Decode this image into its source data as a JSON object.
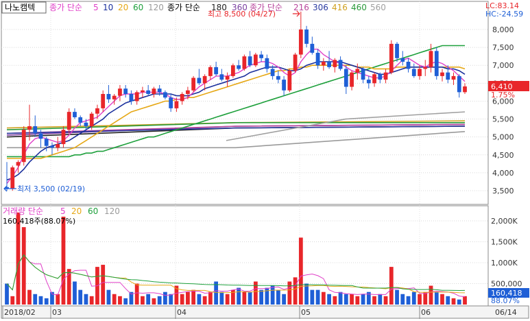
{
  "header": {
    "ticker": "나노캠텍",
    "ma_price_label": "종가 단순",
    "ma_price_periods": [
      "5",
      "10",
      "20",
      "60",
      "120"
    ],
    "ma_price_long_label": "종가 단순",
    "ma_price_long_periods": [
      "180",
      "360"
    ],
    "ma_price_long2_label": "종가 단순",
    "ma_price_long2_periods": [
      "216",
      "306",
      "416",
      "460",
      "560"
    ],
    "lc": "LC:83.14",
    "hc": "HC:-24.59"
  },
  "volume_header": {
    "label": "거래량 단순",
    "periods": [
      "5",
      "20",
      "60",
      "120"
    ],
    "current": "160,418주(88.07%)"
  },
  "annotations": {
    "high": "최고 8,500 (04/27)",
    "low": "최저 3,500 (02/19)"
  },
  "price_badge": {
    "value": "6,410",
    "change": "1.75%"
  },
  "volume_badge": {
    "value": "160,418",
    "pct": "88.07%"
  },
  "colors": {
    "up": "#e8262a",
    "down": "#1f5fd6",
    "ma5": "#e040c8",
    "ma10": "#1a2f9c",
    "ma20": "#e6a816",
    "ma60": "#1ea03c",
    "ma120": "#9a9a9a",
    "ma180": "#222222",
    "ma360": "#7a3fa0",
    "ma216": "#b8469c",
    "ma306": "#2a3aa0",
    "ma416": "#d0a020",
    "ma460": "#2a9a3a",
    "ma560": "#a0a0a0"
  },
  "chart_data": [
    {
      "type": "candlestick",
      "title": "나노캠텍",
      "ylim": [
        3000,
        8500
      ],
      "y_ticks": [
        "3,500",
        "4,000",
        "4,500",
        "5,000",
        "5,500",
        "6,000",
        "6,500",
        "7,000",
        "7,500",
        "8,000"
      ],
      "x_ticks": [
        "2018/02",
        "03",
        "04",
        "05",
        "06",
        "06/14"
      ],
      "candles": [
        [
          3600,
          4300,
          3500,
          3550
        ],
        [
          3550,
          4200,
          3500,
          4150
        ],
        [
          4200,
          4350,
          4000,
          4300
        ],
        [
          4300,
          5300,
          4200,
          5200
        ],
        [
          5200,
          5900,
          4900,
          5300
        ],
        [
          5300,
          5600,
          5000,
          5100
        ],
        [
          5100,
          5200,
          4700,
          4950
        ],
        [
          4950,
          5000,
          4600,
          4750
        ],
        [
          4750,
          4850,
          4500,
          4700
        ],
        [
          4700,
          5000,
          4600,
          4800
        ],
        [
          4800,
          5300,
          4700,
          5200
        ],
        [
          5200,
          5800,
          5100,
          5700
        ],
        [
          5700,
          5800,
          5500,
          5550
        ],
        [
          5550,
          5600,
          5300,
          5400
        ],
        [
          5400,
          5500,
          5200,
          5300
        ],
        [
          5300,
          5700,
          5200,
          5650
        ],
        [
          5650,
          5900,
          5500,
          5800
        ],
        [
          5800,
          6300,
          5700,
          6200
        ],
        [
          6200,
          6450,
          5950,
          6050
        ],
        [
          6050,
          6200,
          5900,
          6150
        ],
        [
          6150,
          6450,
          6000,
          6350
        ],
        [
          6350,
          6450,
          6100,
          6200
        ],
        [
          6200,
          6300,
          5900,
          6000
        ],
        [
          6000,
          6300,
          5900,
          6250
        ],
        [
          6250,
          6400,
          6100,
          6300
        ],
        [
          6300,
          6450,
          6150,
          6200
        ],
        [
          6200,
          6400,
          6100,
          6350
        ],
        [
          6350,
          6450,
          6150,
          6250
        ],
        [
          6250,
          6300,
          6050,
          6100
        ],
        [
          6100,
          6200,
          5700,
          5800
        ],
        [
          5800,
          6100,
          5700,
          6000
        ],
        [
          6000,
          6250,
          5900,
          6200
        ],
        [
          6200,
          6400,
          6050,
          6300
        ],
        [
          6300,
          6700,
          6250,
          6650
        ],
        [
          6650,
          6900,
          6450,
          6500
        ],
        [
          6500,
          6750,
          6300,
          6700
        ],
        [
          6700,
          7000,
          6600,
          6950
        ],
        [
          6950,
          7100,
          6700,
          6750
        ],
        [
          6750,
          6900,
          6550,
          6600
        ],
        [
          6600,
          6800,
          6400,
          6700
        ],
        [
          6700,
          7050,
          6650,
          7000
        ],
        [
          7000,
          7150,
          6850,
          6900
        ],
        [
          6900,
          7300,
          6850,
          7250
        ],
        [
          7250,
          7400,
          6950,
          7000
        ],
        [
          7000,
          7350,
          6950,
          7300
        ],
        [
          7300,
          7400,
          7100,
          7200
        ],
        [
          7200,
          7300,
          6800,
          6900
        ],
        [
          6900,
          7000,
          6600,
          6700
        ],
        [
          6700,
          6850,
          6500,
          6600
        ],
        [
          6600,
          6700,
          6150,
          6300
        ],
        [
          6300,
          6900,
          6250,
          6850
        ],
        [
          6850,
          7350,
          6800,
          7300
        ],
        [
          7300,
          8500,
          7200,
          8000
        ],
        [
          8000,
          8100,
          7500,
          7600
        ],
        [
          7600,
          7800,
          7300,
          7350
        ],
        [
          7350,
          7450,
          6900,
          7000
        ],
        [
          7000,
          7200,
          6850,
          7100
        ],
        [
          7100,
          7400,
          6900,
          6950
        ],
        [
          6950,
          7200,
          6800,
          7150
        ],
        [
          7150,
          7250,
          6850,
          6900
        ],
        [
          6900,
          7000,
          6200,
          6400
        ],
        [
          6400,
          6850,
          6300,
          6800
        ],
        [
          6800,
          7050,
          6600,
          6900
        ],
        [
          6900,
          6950,
          6500,
          6600
        ],
        [
          6600,
          6700,
          6350,
          6500
        ],
        [
          6500,
          6800,
          6400,
          6750
        ],
        [
          6750,
          6800,
          6500,
          6600
        ],
        [
          6600,
          6900,
          6500,
          6800
        ],
        [
          6800,
          7700,
          6750,
          7600
        ],
        [
          7600,
          7650,
          7100,
          7200
        ],
        [
          7200,
          7400,
          7000,
          7100
        ],
        [
          7100,
          7200,
          6800,
          6900
        ],
        [
          6900,
          7050,
          6650,
          6700
        ],
        [
          6700,
          7000,
          6600,
          6900
        ],
        [
          6900,
          7150,
          6700,
          6950
        ],
        [
          6950,
          7600,
          6800,
          7400
        ],
        [
          7400,
          7500,
          6600,
          6700
        ],
        [
          6700,
          6900,
          6550,
          6800
        ],
        [
          6800,
          7000,
          6500,
          6600
        ],
        [
          6600,
          6800,
          6450,
          6700
        ],
        [
          6700,
          6750,
          6100,
          6250
        ],
        [
          6250,
          6500,
          6200,
          6410
        ]
      ],
      "ma5": [
        3700,
        3900,
        4150,
        4500,
        4800,
        4950,
        5000,
        4950,
        4900,
        4850,
        4900,
        5050,
        5250,
        5400,
        5450,
        5500,
        5550,
        5700,
        5850,
        6000,
        6150,
        6200,
        6200,
        6200,
        6250,
        6250,
        6250,
        6250,
        6200,
        6100,
        6050,
        6050,
        6100,
        6250,
        6400,
        6500,
        6600,
        6700,
        6700,
        6700,
        6750,
        6800,
        6900,
        7000,
        7050,
        7100,
        7100,
        7050,
        6950,
        6800,
        6700,
        6800,
        7100,
        7300,
        7450,
        7450,
        7300,
        7200,
        7100,
        7050,
        6950,
        6850,
        6800,
        6750,
        6700,
        6650,
        6650,
        6700,
        6850,
        7000,
        7150,
        7200,
        7100,
        7000,
        6950,
        7050,
        7100,
        7050,
        6950,
        6850,
        6700,
        6550
      ],
      "ma10": [
        3800,
        3850,
        3950,
        4100,
        4300,
        4450,
        4600,
        4700,
        4750,
        4800,
        4850,
        4900,
        5000,
        5100,
        5200,
        5300,
        5400,
        5500,
        5650,
        5750,
        5850,
        5950,
        6000,
        6050,
        6100,
        6150,
        6200,
        6200,
        6200,
        6200,
        6150,
        6150,
        6150,
        6200,
        6250,
        6350,
        6400,
        6450,
        6500,
        6550,
        6600,
        6650,
        6700,
        6800,
        6850,
        6900,
        6950,
        6950,
        6950,
        6900,
        6850,
        6850,
        6900,
        7000,
        7050,
        7100,
        7100,
        7100,
        7100,
        7100,
        7050,
        7000,
        6950,
        6900,
        6850,
        6800,
        6750,
        6750,
        6800,
        6850,
        6900,
        6950,
        6950,
        6950,
        6950,
        6950,
        6950,
        6950,
        6900,
        6900,
        6850,
        6750
      ],
      "ma20": [
        4400,
        4400,
        4400,
        4400,
        4400,
        4400,
        4400,
        4450,
        4500,
        4550,
        4600,
        4650,
        4700,
        4800,
        4900,
        5000,
        5100,
        5200,
        5300,
        5400,
        5500,
        5600,
        5700,
        5750,
        5800,
        5850,
        5900,
        5950,
        6000,
        6000,
        6050,
        6050,
        6100,
        6100,
        6150,
        6200,
        6250,
        6300,
        6350,
        6400,
        6450,
        6500,
        6550,
        6600,
        6650,
        6700,
        6750,
        6800,
        6850,
        6850,
        6900,
        6900,
        6950,
        6950,
        7000,
        7000,
        7000,
        7000,
        7000,
        7000,
        7000,
        7000,
        6950,
        6950,
        6950,
        6900,
        6900,
        6900,
        6900,
        6950,
        6950,
        6950,
        6950,
        6950,
        6950,
        6950,
        6950,
        6950,
        6950,
        6950,
        6950,
        6900
      ],
      "ma60": [
        4450,
        4450,
        4450,
        4450,
        4450,
        4450,
        4450,
        4450,
        4450,
        4450,
        4450,
        4450,
        4500,
        4500,
        4550,
        4550,
        4600,
        4600,
        4650,
        4700,
        4750,
        4800,
        4850,
        4900,
        4950,
        5000,
        5000,
        5050,
        5100,
        5150,
        5200,
        5250,
        5300,
        5350,
        5400,
        5450,
        5500,
        5550,
        5600,
        5650,
        5700,
        5750,
        5800,
        5850,
        5900,
        5950,
        6000,
        6050,
        6100,
        6150,
        6200,
        6250,
        6300,
        6350,
        6400,
        6450,
        6500,
        6550,
        6600,
        6650,
        6700,
        6750,
        6800,
        6850,
        6900,
        6950,
        7000,
        7050,
        7100,
        7150,
        7200,
        7250,
        7300,
        7350,
        7400,
        7450,
        7500,
        7550,
        7550,
        7550,
        7550,
        7550
      ],
      "ma_longs": [
        {
          "name": "120",
          "y": [
            4700,
            4700,
            5150
          ]
        },
        {
          "name": "180",
          "y": [
            5000,
            5250,
            5300
          ]
        },
        {
          "name": "360",
          "y": [
            5050,
            5300,
            5350
          ]
        },
        {
          "name": "216",
          "y": [
            5100,
            5300,
            5350
          ]
        },
        {
          "name": "306",
          "y": [
            5100,
            5250,
            5300
          ]
        },
        {
          "name": "416",
          "y": [
            5250,
            5400,
            5450
          ]
        },
        {
          "name": "460",
          "y": [
            5200,
            5400,
            5400
          ]
        },
        {
          "name": "560",
          "y": [
            4900,
            5500,
            5700
          ]
        }
      ]
    },
    {
      "type": "bar",
      "title": "거래량",
      "ylim": [
        0,
        2300000
      ],
      "y_ticks": [
        "500,000",
        "1,000K",
        "1,500K",
        "2,000K"
      ],
      "values": [
        500000,
        200000,
        2200000,
        1850000,
        350000,
        250000,
        200000,
        150000,
        300000,
        250000,
        2100000,
        850000,
        550000,
        350000,
        250000,
        200000,
        900000,
        950000,
        350000,
        250000,
        200000,
        150000,
        300000,
        500000,
        200000,
        250000,
        150000,
        200000,
        300000,
        250000,
        450000,
        250000,
        300000,
        350000,
        250000,
        200000,
        300000,
        550000,
        300000,
        250000,
        350000,
        400000,
        300000,
        300000,
        550000,
        350000,
        400000,
        450000,
        350000,
        250000,
        550000,
        650000,
        1600000,
        500000,
        350000,
        350000,
        300000,
        250000,
        200000,
        300000,
        250000,
        250000,
        200000,
        250000,
        300000,
        200000,
        250000,
        200000,
        900000,
        350000,
        250000,
        200000,
        300000,
        250000,
        300000,
        450000,
        300000,
        250000,
        200000,
        150000,
        120000,
        200000
      ],
      "current": 160418
    }
  ]
}
